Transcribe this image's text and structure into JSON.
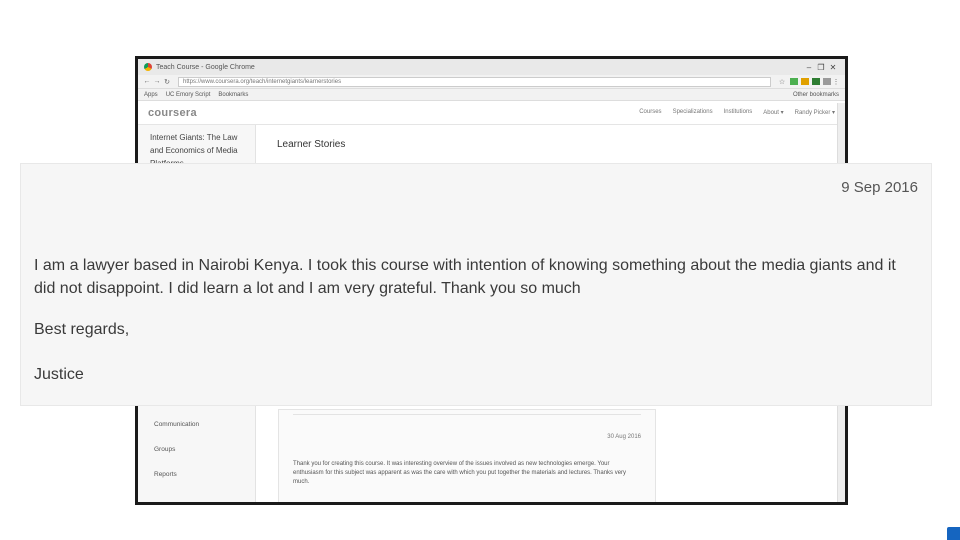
{
  "browser": {
    "window_title": "Teach Course - Google Chrome",
    "url": "https://www.coursera.org/teach/internetgiants/learnerstories",
    "bookmarks": [
      "Apps",
      "UC Emory Script",
      "Bookmarks"
    ],
    "other_bookmarks": "Other bookmarks"
  },
  "site": {
    "logo": "coursera",
    "nav": [
      "Courses",
      "Specializations",
      "Institutions",
      "About ▾",
      "Randy Picker ▾"
    ]
  },
  "sidebar": {
    "course_title": "Internet Giants: The Law and Economics of Media Platforms",
    "links": [
      "Communication",
      "Groups",
      "Reports"
    ]
  },
  "main": {
    "heading": "Learner Stories"
  },
  "second_story": {
    "date": "30 Aug 2016",
    "body": "Thank you for creating this course. It was interesting overview of the issues involved as new technologies emerge. Your enthusiasm for this subject was apparent as was the care with which you put together the materials and lectures. Thanks very much."
  },
  "zoomed_story": {
    "date": "9 Sep 2016",
    "body": "I am a lawyer based in Nairobi Kenya. I took this course with intention of knowing something about the media giants and it did not disappoint. I did learn a lot and I am very grateful. Thank you so much",
    "regards": "Best regards,",
    "signature": "Justice"
  }
}
